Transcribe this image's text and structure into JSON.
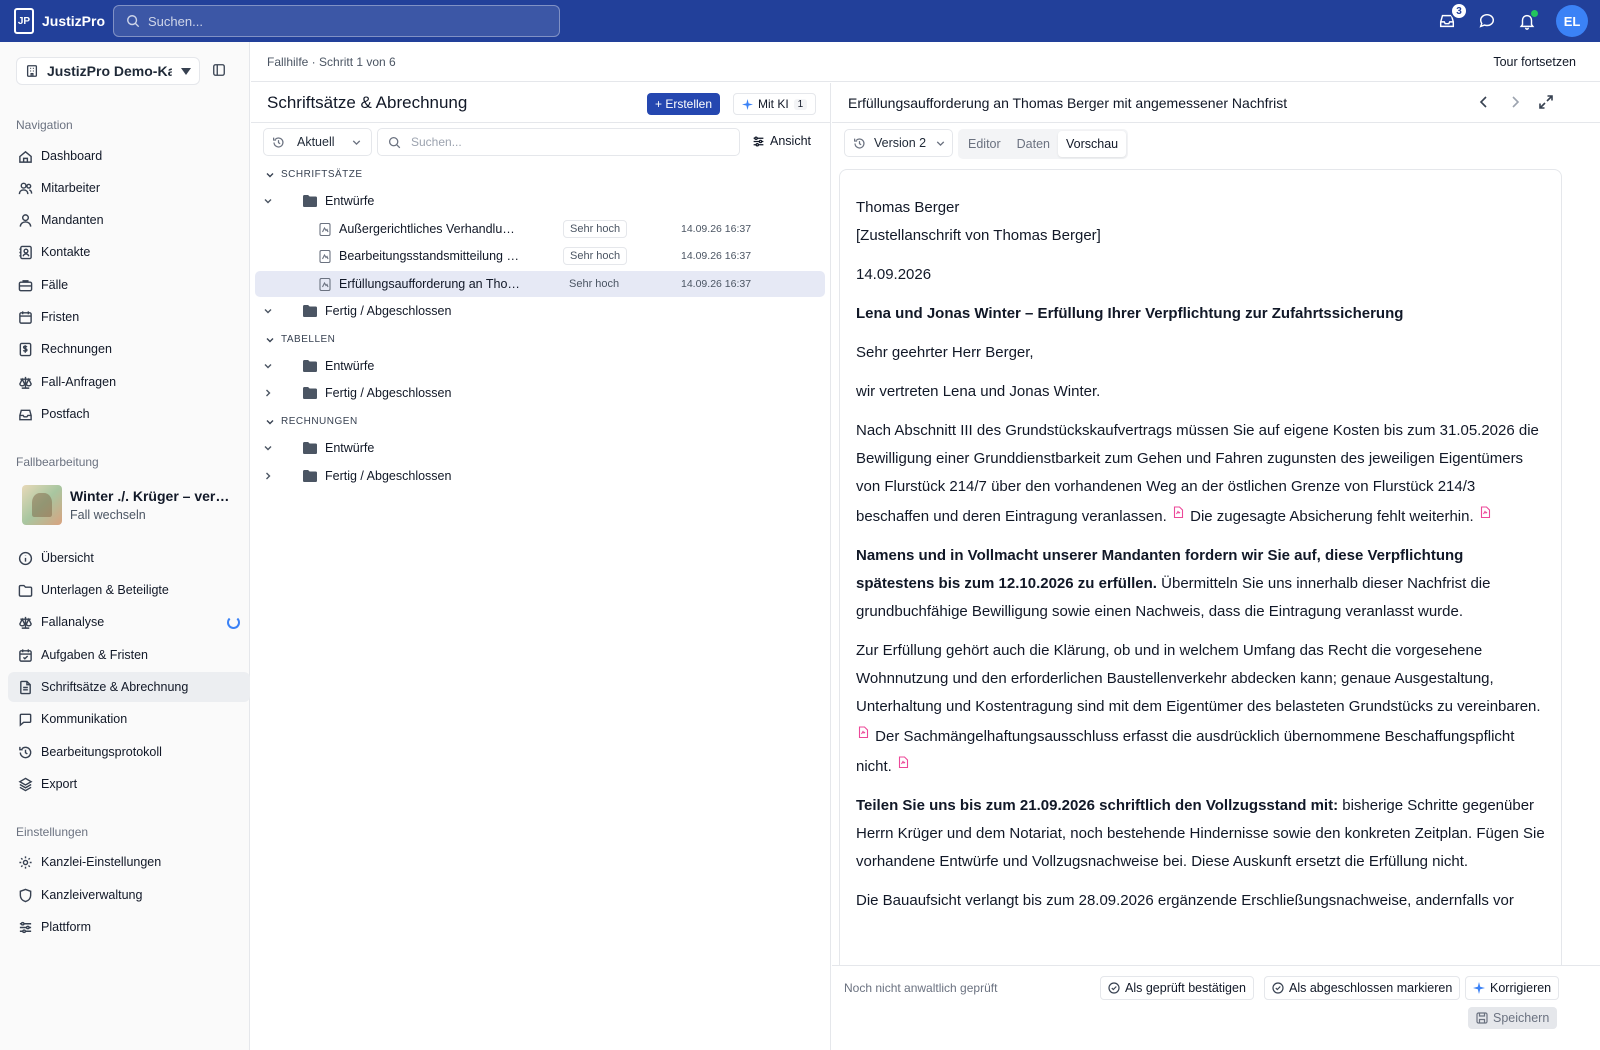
{
  "app": {
    "name": "JustizPro",
    "logo_text": "JP"
  },
  "topbar": {
    "search_placeholder": "Suchen...",
    "inbox_count": "3",
    "user_initials": "EL",
    "colors": {
      "bar": "#22409a",
      "avatar": "#3b82f6",
      "online": "#22c55e"
    }
  },
  "sidebar": {
    "workspace": "JustizPro Demo-Kanzlei",
    "nav_label": "Navigation",
    "nav_items": [
      {
        "label": "Dashboard",
        "icon": "dashboard-icon"
      },
      {
        "label": "Mitarbeiter",
        "icon": "users-icon"
      },
      {
        "label": "Mandanten",
        "icon": "user-icon"
      },
      {
        "label": "Kontakte",
        "icon": "contacts-icon"
      },
      {
        "label": "Fälle",
        "icon": "briefcase-icon"
      },
      {
        "label": "Fristen",
        "icon": "calendar-icon"
      },
      {
        "label": "Rechnungen",
        "icon": "invoice-icon"
      },
      {
        "label": "Fall-Anfragen",
        "icon": "scale-icon"
      },
      {
        "label": "Postfach",
        "icon": "inbox-icon"
      }
    ],
    "case_label": "Fallbearbeitung",
    "case": {
      "title": "Winter ./. Krüger – verweigerte Zufahrt",
      "switch": "Fall wechseln"
    },
    "case_items": [
      {
        "label": "Übersicht",
        "icon": "info-icon"
      },
      {
        "label": "Unterlagen & Beteiligte",
        "icon": "folder-icon"
      },
      {
        "label": "Fallanalyse",
        "icon": "scale-icon"
      },
      {
        "label": "Aufgaben & Fristen",
        "icon": "calendar-check-icon"
      },
      {
        "label": "Schriftsätze & Abrechnung",
        "icon": "document-icon"
      },
      {
        "label": "Kommunikation",
        "icon": "chat-icon"
      },
      {
        "label": "Bearbeitungsprotokoll",
        "icon": "history-icon"
      },
      {
        "label": "Export",
        "icon": "export-icon"
      }
    ],
    "settings_label": "Einstellungen",
    "settings_items": [
      {
        "label": "Kanzlei-Einstellungen",
        "icon": "gear-icon"
      },
      {
        "label": "Kanzleiverwaltung",
        "icon": "shield-icon"
      },
      {
        "label": "Plattform",
        "icon": "sliders-icon"
      }
    ]
  },
  "header": {
    "breadcrumb": "Fallhilfe · Schritt 1 von 6",
    "tour": "Tour fortsetzen"
  },
  "middle": {
    "title": "Schriftsätze & Abrechnung",
    "create": "+ Erstellen",
    "ki": "Mit KI",
    "ki_count": "1",
    "filter": "Aktuell",
    "search_placeholder": "Suchen...",
    "view": "Ansicht",
    "sections": [
      {
        "label": "SCHRIFTSÄTZE",
        "folders": [
          {
            "label": "Entwürfe",
            "docs": [
              {
                "name": "Außergerichtliches Verhandlungsangebot",
                "priority": "Sehr hoch",
                "date": "14.09.26 16:37"
              },
              {
                "name": "Bearbeitungsstandsmitteilung an Mandanten",
                "priority": "Sehr hoch",
                "date": "14.09.26 16:37"
              },
              {
                "name": "Erfüllungsaufforderung an Thomas Berger",
                "priority": "Sehr hoch",
                "date": "14.09.26 16:37"
              }
            ]
          },
          {
            "label": "Fertig / Abgeschlossen",
            "docs": []
          }
        ]
      },
      {
        "label": "TABELLEN",
        "folders": [
          {
            "label": "Entwürfe"
          },
          {
            "label": "Fertig / Abgeschlossen"
          }
        ]
      },
      {
        "label": "RECHNUNGEN",
        "folders": [
          {
            "label": "Entwürfe"
          },
          {
            "label": "Fertig / Abgeschlossen"
          }
        ]
      }
    ]
  },
  "right": {
    "title": "Erfüllungsaufforderung an Thomas Berger mit angemessener Nachfrist",
    "version": "Version 2",
    "tabs": [
      "Editor",
      "Daten",
      "Vorschau"
    ],
    "letter": {
      "recipient": "Thomas Berger",
      "address": "[Zustellanschrift von Thomas Berger]",
      "date": "14.09.2026",
      "subject": "Lena und Jonas Winter – Erfüllung Ihrer Verpflichtung zur Zufahrtssicherung",
      "salutation": "Sehr geehrter Herr Berger,",
      "intro": "wir vertreten Lena und Jonas Winter.",
      "p1a": "Nach Abschnitt III des Grundstückskaufvertrags müssen Sie auf eigene Kosten bis zum 31.05.2026 die Bewilligung einer Grunddienstbarkeit zum Gehen und Fahren zugunsten des jeweiligen Eigentümers von Flurstück 214/7 über den vorhandenen Weg an der östlichen Grenze von Flurstück 214/3 beschaffen und deren Eintragung veranlassen.",
      "p1b": "Die zugesagte Absicherung fehlt weiterhin.",
      "p2bold": "Namens und in Vollmacht unserer Mandanten fordern wir Sie auf, diese Verpflichtung spätestens bis zum 12.10.2026 zu erfüllen.",
      "p2": "Übermitteln Sie uns innerhalb dieser Nachfrist die grundbuchfähige Bewilligung sowie einen Nachweis, dass die Eintragung veranlasst wurde.",
      "p3a": "Zur Erfüllung gehört auch die Klärung, ob und in welchem Umfang das Recht die vorgesehene Wohnnutzung und den erforderlichen Baustellenverkehr abdecken kann; genaue Ausgestaltung, Unterhaltung und Kostentragung sind mit dem Eigentümer des belasteten Grundstücks zu vereinbaren.",
      "p3b": "Der Sachmängelhaftungsausschluss erfasst die ausdrücklich übernommene Beschaffungspflicht nicht.",
      "p4bold": "Teilen Sie uns bis zum 21.09.2026 schriftlich den Vollzugsstand mit:",
      "p4": "bisherige Schritte gegenüber Herrn Krüger und dem Notariat, noch bestehende Hindernisse sowie den konkreten Zeitplan. Fügen Sie vorhandene Entwürfe und Vollzugsnachweise bei. Diese Auskunft ersetzt die Erfüllung nicht.",
      "p5": "Die Bauaufsicht verlangt bis zum 28.09.2026 ergänzende Erschließungsnachweise, andernfalls vor"
    },
    "footer": {
      "status": "Noch nicht anwaltlich geprüft",
      "confirm": "Als geprüft bestätigen",
      "complete": "Als abgeschlossen markieren",
      "correct": "Korrigieren",
      "save": "Speichern"
    }
  }
}
